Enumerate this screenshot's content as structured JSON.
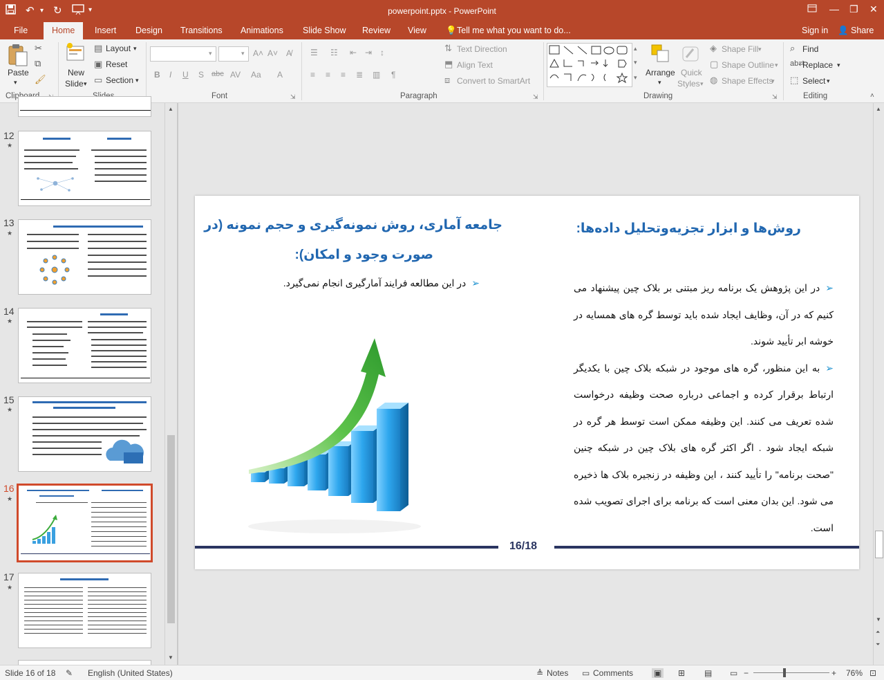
{
  "titlebar": {
    "title": "powerpoint.pptx - PowerPoint",
    "colors": {
      "accent": "#b7472a"
    }
  },
  "tabs": {
    "file": "File",
    "home": "Home",
    "insert": "Insert",
    "design": "Design",
    "transitions": "Transitions",
    "animations": "Animations",
    "slideshow": "Slide Show",
    "review": "Review",
    "view": "View",
    "tellme": "Tell me what you want to do...",
    "signin": "Sign in",
    "share": "Share"
  },
  "ribbon": {
    "clipboard": {
      "label": "Clipboard",
      "paste": "Paste"
    },
    "slides": {
      "label": "Slides",
      "new_slide_1": "New",
      "new_slide_2": "Slide",
      "layout": "Layout",
      "reset": "Reset",
      "section": "Section"
    },
    "font": {
      "label": "Font"
    },
    "paragraph": {
      "label": "Paragraph",
      "text_direction": "Text Direction",
      "align_text": "Align Text",
      "convert_smartart": "Convert to SmartArt"
    },
    "drawing": {
      "label": "Drawing",
      "arrange": "Arrange",
      "quick_styles_1": "Quick",
      "quick_styles_2": "Styles",
      "shape_fill": "Shape Fill",
      "shape_outline": "Shape Outline",
      "shape_effects": "Shape Effects"
    },
    "editing": {
      "label": "Editing",
      "find": "Find",
      "replace": "Replace",
      "select": "Select"
    }
  },
  "thumbnails": [
    {
      "number": "12"
    },
    {
      "number": "13"
    },
    {
      "number": "14"
    },
    {
      "number": "15"
    },
    {
      "number": "16"
    },
    {
      "number": "17"
    }
  ],
  "slide": {
    "right_title": "روش‌ها و ابزار تجزیه‌وتحلیل داده‌ها:",
    "right_para1": "در این پژوهش یک برنامه ریز مبتنی بر بلاک چین پیشنهاد می کنیم که در آن، وظایف ایجاد شده باید توسط گره های همسایه در خوشه ابر تأیید شوند.",
    "right_para2": "به این منظور، گره های موجود در شبکه بلاک چین با یکدیگر ارتباط برقرار کرده و اجماعی درباره صحت وظیفه درخواست شده تعریف می کنند. این وظیفه ممکن است توسط هر گره در شبکه ایجاد شود . اگر اکثر گره های بلاک چین در شبکه چنین \"صحت برنامه\" را تأیید کنند ، این وظیفه در زنجیره بلاک ها ذخیره می شود. این بدان معنی است که برنامه برای اجرای تصویب شده است.",
    "left_title_1": "جامعه آماری، روش نمونه‌گیری و حجم نمونه (در",
    "left_title_2": "صورت وجود و امکان):",
    "left_para": "در این مطالعه فرایند آمارگیری انجام نمی‌گیرد.",
    "page_number": "16/18"
  },
  "status": {
    "slide_info": "Slide 16 of 18",
    "language": "English (United States)",
    "notes": "Notes",
    "comments": "Comments",
    "zoom": "76%"
  }
}
